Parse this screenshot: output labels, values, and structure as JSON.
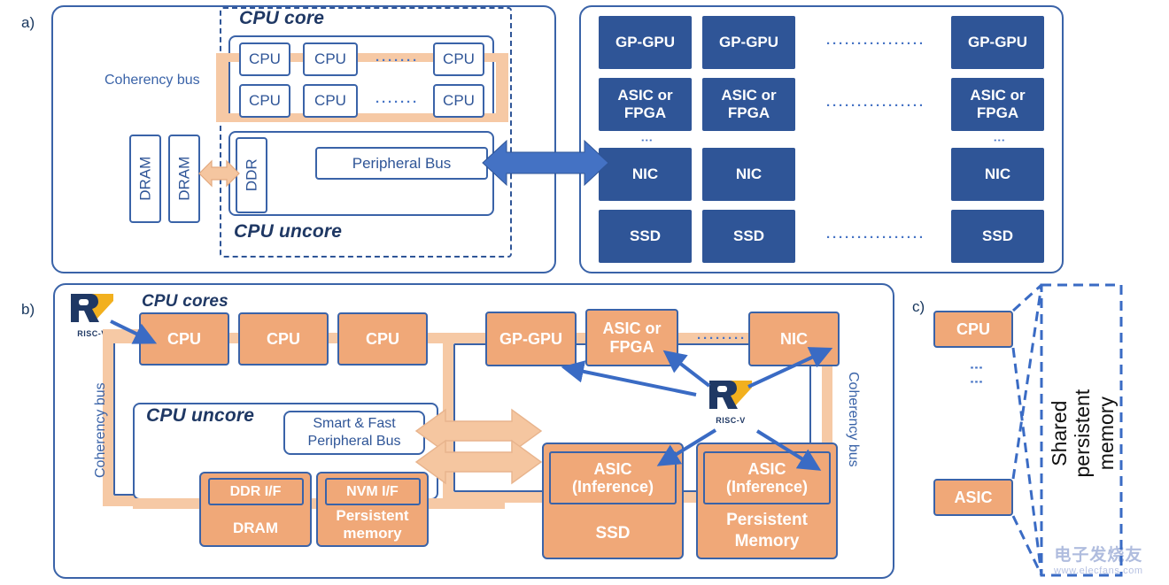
{
  "figure": {
    "panels": [
      {
        "key": "a",
        "label": "a)"
      },
      {
        "key": "b",
        "label": "b)"
      },
      {
        "key": "c",
        "label": "c)"
      }
    ],
    "colors": {
      "dark_blue": "#2F5597",
      "border_blue": "#3A63A8",
      "arrow_blue": "#4472C4",
      "peach": "#F0A878",
      "light_peach": "#F6C9A5",
      "pale_arrow": "#F5C6A0",
      "riscv_gold": "#F2B01E",
      "riscv_navy": "#1F3864",
      "white": "#FFFFFF"
    }
  },
  "panel_a": {
    "label": "a)",
    "coherency_bus_label": "Coherency bus",
    "cpu_core_title": "CPU core",
    "cpu_uncore_title": "CPU uncore",
    "core_row_1": [
      "CPU",
      "CPU",
      "CPU"
    ],
    "core_row_2": [
      "CPU",
      "CPU",
      "CPU"
    ],
    "row_ellipsis": "·······",
    "dram_blocks": [
      "DRAM",
      "DRAM"
    ],
    "ddr_label": "DDR",
    "peripheral_bus_label": "Peripheral Bus",
    "accel_columns": [
      {
        "cells": [
          "GP-GPU",
          "ASIC or\nFPGA",
          "NIC",
          "SSD"
        ]
      },
      {
        "cells": [
          "GP-GPU",
          "ASIC or\nFPGA",
          "NIC",
          "SSD"
        ]
      },
      {
        "cells": [
          "GP-GPU",
          "ASIC or\nFPGA",
          "NIC",
          "SSD"
        ]
      }
    ],
    "accel_rows": [
      "GP-GPU",
      "ASIC or FPGA",
      "NIC",
      "SSD"
    ],
    "column_ellipsis": "················",
    "vertical_ellipsis": "⋮"
  },
  "panel_b": {
    "label": "b)",
    "riscv_logo_text": "RISC-V",
    "cpu_cores_title": "CPU cores",
    "cpu_uncore_title": "CPU uncore",
    "coherency_bus_left": "Coherency bus",
    "coherency_bus_right": "Coherency bus",
    "cores": [
      "CPU",
      "CPU",
      "CPU"
    ],
    "peripheral_bus_line1": "Smart & Fast",
    "peripheral_bus_line2": "Peripheral  Bus",
    "memory_units": [
      {
        "iface": "DDR I/F",
        "body": "DRAM"
      },
      {
        "iface": "NVM I/F",
        "body": "Persistent\nmemory"
      }
    ],
    "accelerators": [
      "GP-GPU",
      "ASIC or\nFPGA",
      "NIC"
    ],
    "accel_ellipsis": "········",
    "storage_units": [
      {
        "iface": "ASIC\n(Inference)",
        "body": "SSD"
      },
      {
        "iface": "ASIC\n(Inference)",
        "body": "Persistent\nMemory"
      }
    ]
  },
  "panel_c": {
    "label": "c)",
    "nodes": [
      "CPU",
      "ASIC"
    ],
    "vertical_ellipsis": "⋮",
    "shared_memory_label": "Shared persistent memory"
  },
  "watermark": {
    "cn": "电子发烧友",
    "url": "www.elecfans.com"
  }
}
